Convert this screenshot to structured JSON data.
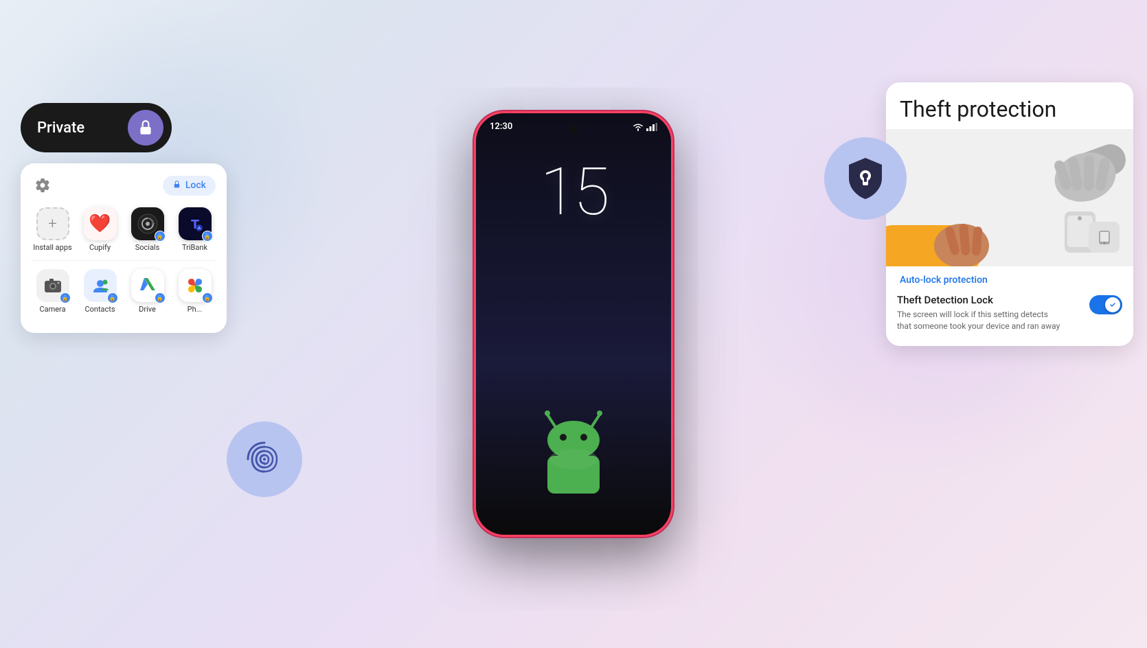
{
  "background": {
    "gradient": "linear-gradient to bottom-right: light blue-gray to light purple"
  },
  "phone": {
    "status_time": "12:30",
    "clock_number": "15",
    "border_color": "#ff4060"
  },
  "private_pill": {
    "label": "Private",
    "lock_icon": "🔒"
  },
  "app_grid": {
    "lock_badge_label": "Lock",
    "rows": [
      [
        {
          "name": "Install apps",
          "icon": "+",
          "type": "install"
        },
        {
          "name": "Cupify",
          "icon": "❤️",
          "type": "cupify"
        },
        {
          "name": "Socials",
          "icon": "◎",
          "type": "socials",
          "has_lock": true
        },
        {
          "name": "TriBank",
          "icon": "₿",
          "type": "tribank",
          "has_lock": true
        }
      ],
      [
        {
          "name": "Camera",
          "icon": "📷",
          "type": "camera",
          "has_lock": true
        },
        {
          "name": "Contacts",
          "icon": "👤",
          "type": "contacts",
          "has_lock": true
        },
        {
          "name": "Drive",
          "icon": "△",
          "type": "drive",
          "has_lock": true
        },
        {
          "name": "Photos",
          "icon": "✿",
          "type": "photos",
          "has_lock": true
        }
      ]
    ]
  },
  "theft_protection": {
    "title": "Theft protection",
    "auto_lock_link": "Auto-lock protection",
    "detection_title": "Theft Detection Lock",
    "detection_desc": "The screen will lock if this setting detects that someone took your device and ran away",
    "toggle_enabled": true
  }
}
